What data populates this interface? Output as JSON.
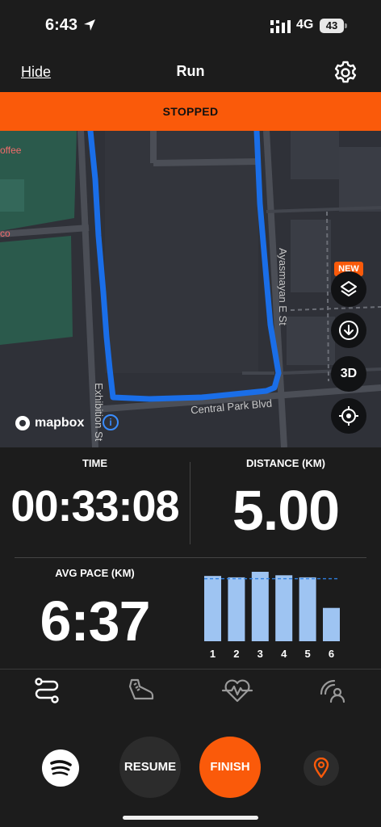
{
  "status_bar": {
    "time": "6:43",
    "network": "4G",
    "battery": "43"
  },
  "header": {
    "hide_label": "Hide",
    "title": "Run"
  },
  "banner": {
    "text": "STOPPED"
  },
  "map": {
    "poi_labels": [
      "offee",
      "co"
    ],
    "streets": [
      "Ayasmayan E St",
      "Central Park Blvd",
      "Exhibition St"
    ],
    "new_badge": "NEW",
    "btn_3d": "3D",
    "attribution": "mapbox",
    "info_icon": "i",
    "route_color": "#1a6ee8"
  },
  "stats": {
    "time_label": "TIME",
    "time_value": "00:33:08",
    "distance_label": "DISTANCE (KM)",
    "distance_value": "5.00",
    "pace_label": "AVG PACE (KM)",
    "pace_value": "6:37"
  },
  "chart_data": {
    "type": "bar",
    "categories": [
      "1",
      "2",
      "3",
      "4",
      "5",
      "6"
    ],
    "values": [
      0.94,
      0.92,
      1.0,
      0.95,
      0.92,
      0.48
    ],
    "average_line": 0.9,
    "bar_color": "#9ec4f2"
  },
  "tabs": [
    {
      "name": "route-icon",
      "active": true
    },
    {
      "name": "shoe-icon",
      "active": false
    },
    {
      "name": "heart-rate-icon",
      "active": false
    },
    {
      "name": "beacon-icon",
      "active": false
    }
  ],
  "controls": {
    "resume_label": "RESUME",
    "finish_label": "FINISH",
    "accent": "#fa5a0a"
  }
}
